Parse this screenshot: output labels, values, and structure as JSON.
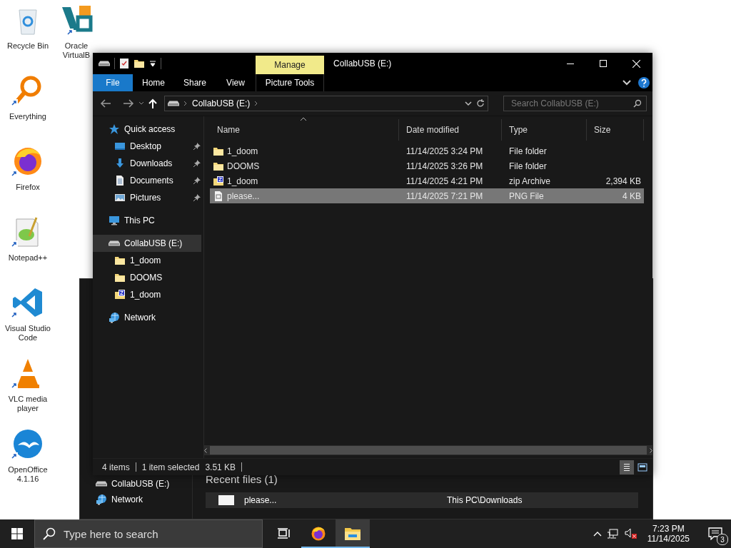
{
  "desktop_icons": [
    {
      "label": "Recycle Bin",
      "kind": "recycle",
      "shortcut": false
    },
    {
      "label": "Everything",
      "kind": "everything",
      "shortcut": true
    },
    {
      "label": "Firefox",
      "kind": "firefox",
      "shortcut": true
    },
    {
      "label": "Notepad++",
      "kind": "notepad",
      "shortcut": true
    },
    {
      "label": "Visual Studio Code",
      "kind": "vscode",
      "shortcut": true
    },
    {
      "label": "VLC media player",
      "kind": "vlc",
      "shortcut": true
    },
    {
      "label": "OpenOffice 4.1.16",
      "kind": "openoffice",
      "shortcut": true
    },
    {
      "label": "Oracle VirtualB",
      "kind": "vbox",
      "shortcut": true
    }
  ],
  "back_window": {
    "nav_items": [
      {
        "label": "CollabUSB (E:)",
        "kind": "drive"
      },
      {
        "label": "Network",
        "kind": "network"
      }
    ],
    "section_title": "Recent files (1)",
    "recent_files": [
      {
        "name": "please...",
        "location": "This PC\\Downloads"
      }
    ]
  },
  "front_window": {
    "title": "CollabUSB (E:)",
    "context_group": "Manage",
    "ribbon_tabs": [
      {
        "label": "File",
        "kind": "file"
      },
      {
        "label": "Home",
        "kind": "tab"
      },
      {
        "label": "Share",
        "kind": "tab"
      },
      {
        "label": "View",
        "kind": "tab"
      },
      {
        "label": "Picture Tools",
        "kind": "context"
      }
    ],
    "address": {
      "path": [
        "CollabUSB (E:)"
      ]
    },
    "search": {
      "placeholder": "Search CollabUSB (E:)"
    },
    "nav_tree": [
      {
        "label": "Quick access",
        "kind": "star",
        "selected": false,
        "children": [
          {
            "label": "Desktop",
            "kind": "desktop",
            "selected": false,
            "pinned": true
          },
          {
            "label": "Downloads",
            "kind": "downloads",
            "selected": false,
            "pinned": true
          },
          {
            "label": "Documents",
            "kind": "documents",
            "selected": false,
            "pinned": true
          },
          {
            "label": "Pictures",
            "kind": "pictures",
            "selected": false,
            "pinned": true
          }
        ]
      },
      {
        "label": "This PC",
        "kind": "pc",
        "selected": false
      },
      {
        "label": "CollabUSB (E:)",
        "kind": "drive",
        "selected": true,
        "children": [
          {
            "label": "1_doom",
            "kind": "folder",
            "selected": false
          },
          {
            "label": "DOOMS",
            "kind": "folder",
            "selected": false
          },
          {
            "label": "1_doom",
            "kind": "zip",
            "selected": false
          }
        ]
      },
      {
        "label": "Network",
        "kind": "network",
        "selected": false
      }
    ],
    "columns": [
      {
        "label": "Name",
        "sorted": true
      },
      {
        "label": "Date modified"
      },
      {
        "label": "Type"
      },
      {
        "label": "Size"
      }
    ],
    "files": [
      {
        "name": "1_doom",
        "kind": "folder",
        "date": "11/14/2025 3:24 PM",
        "type": "File folder",
        "selected": false
      },
      {
        "name": "DOOMS",
        "kind": "folder",
        "date": "11/14/2025 3:26 PM",
        "type": "File folder",
        "selected": false
      },
      {
        "name": "1_doom",
        "kind": "zip",
        "date": "11/14/2025 4:21 PM",
        "type": "zip Archive",
        "size": "2,394 KB",
        "selected": false
      },
      {
        "name": "please...",
        "kind": "png",
        "date": "11/14/2025 7:21 PM",
        "type": "PNG File",
        "size": "4 KB",
        "selected": true
      }
    ],
    "status_bar": {
      "count": "4 items",
      "selection": "1 item selected",
      "selection_size": "3.51 KB",
      "views": [
        {
          "kind": "details",
          "selected": true
        },
        {
          "kind": "tiles",
          "selected": false
        }
      ]
    }
  },
  "taskbar": {
    "search": {
      "placeholder": "Type here to search"
    },
    "apps": [
      {
        "kind": "taskview",
        "running": false,
        "selected": false
      },
      {
        "kind": "firefox",
        "running": true,
        "selected": false
      },
      {
        "kind": "explorer",
        "running": true,
        "selected": true
      }
    ],
    "time": "7:23 PM",
    "date": "11/14/2025",
    "notifications": "3"
  }
}
